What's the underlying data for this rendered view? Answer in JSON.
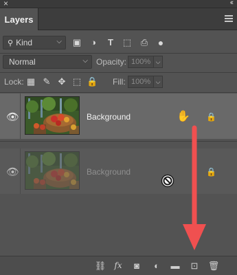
{
  "window": {
    "close_glyph": "×",
    "collapse_glyph": "‹‹",
    "menu_icon": "hamburger-icon"
  },
  "tab": {
    "label": "Layers"
  },
  "filter": {
    "kind_value": "Kind",
    "icons": [
      "pixel-filter-icon",
      "adjustment-filter-icon",
      "type-filter-icon",
      "shape-filter-icon",
      "smart-object-filter-icon",
      "filter-toggle-icon"
    ]
  },
  "blend": {
    "mode_value": "Normal",
    "opacity_label": "Opacity:",
    "opacity_value": "100%"
  },
  "lock": {
    "label": "Lock:",
    "fill_label": "Fill:",
    "fill_value": "100%",
    "icons": [
      "lock-transparency-icon",
      "lock-pixels-icon",
      "lock-position-icon",
      "lock-artboard-icon",
      "lock-all-icon"
    ]
  },
  "layers": [
    {
      "name": "Background",
      "visible": true,
      "locked": true,
      "state": "selected"
    },
    {
      "name": "Background",
      "visible": true,
      "locked": true,
      "state": "drag-ghost"
    }
  ],
  "bottom_toolbar": {
    "icons": [
      "link-layers-icon",
      "fx-icon",
      "add-mask-icon",
      "adjustment-layer-icon",
      "group-folder-icon",
      "new-layer-icon",
      "trash-icon"
    ]
  },
  "annotation": {
    "arrow_color": "#f05050"
  },
  "colors": {
    "panel_bg": "#535353",
    "selected_row": "#696969"
  }
}
